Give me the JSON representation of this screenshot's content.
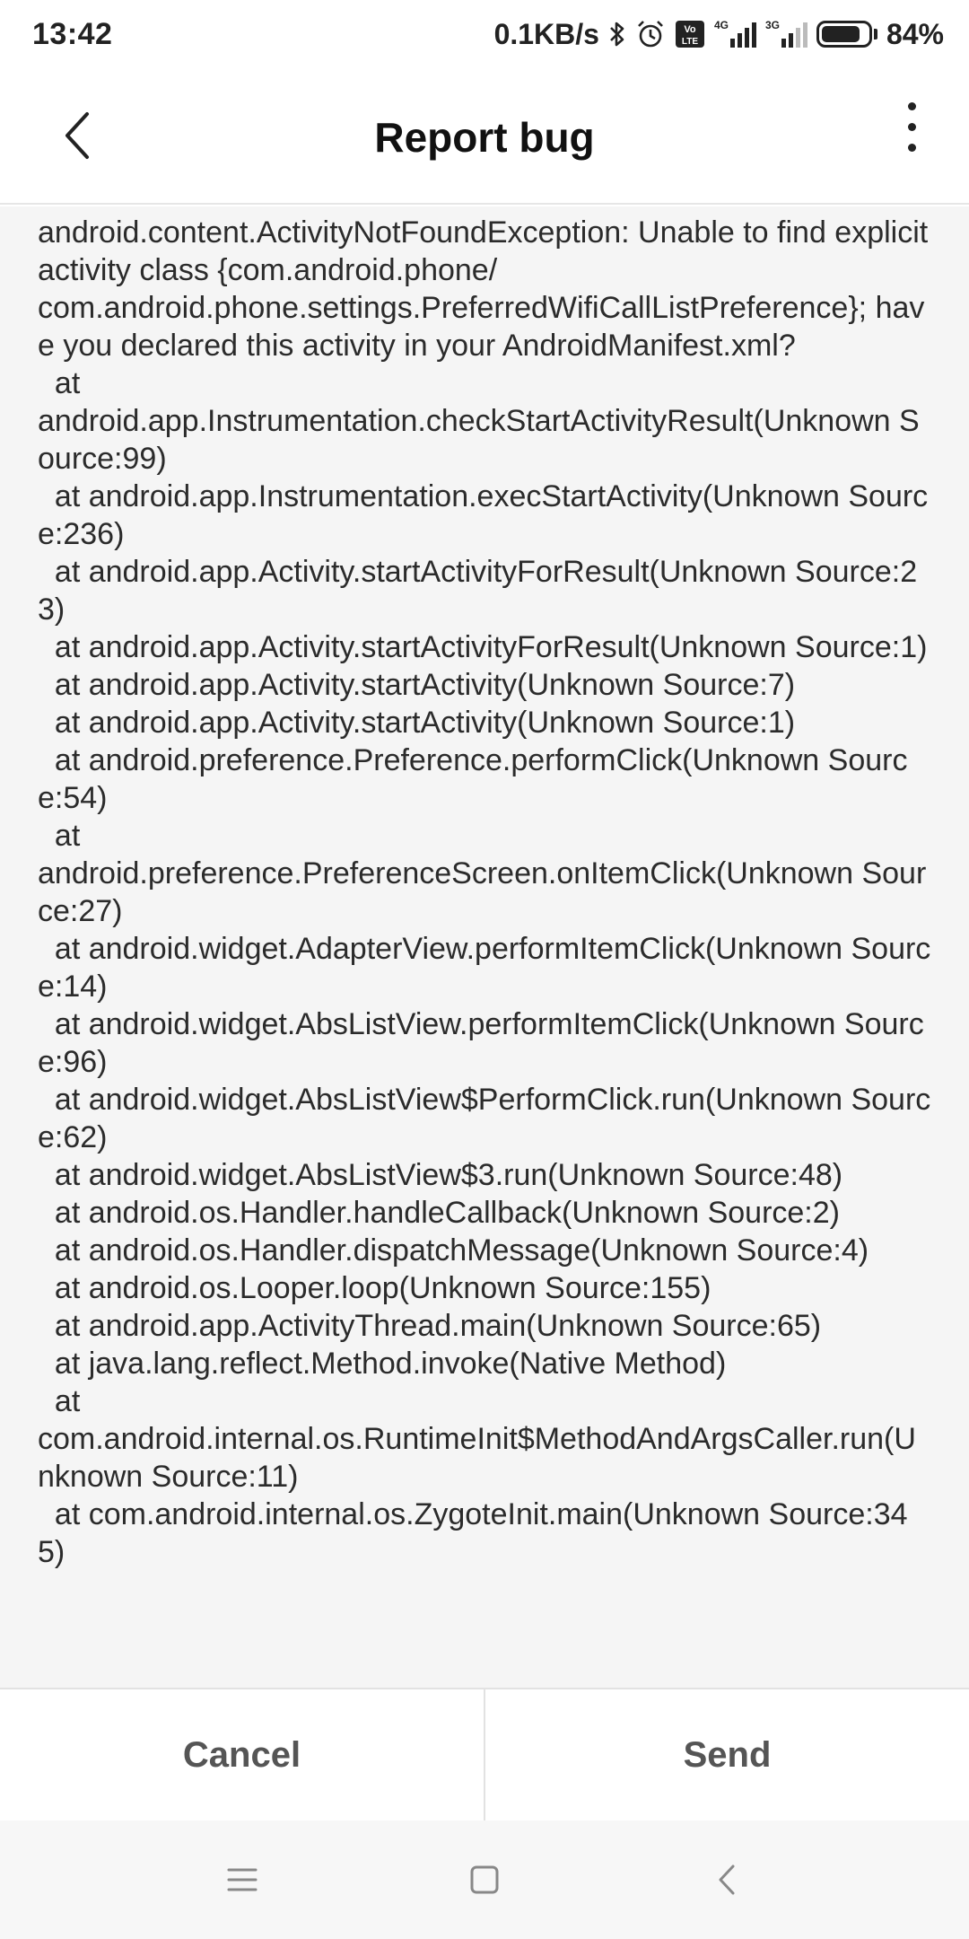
{
  "status_bar": {
    "time": "13:42",
    "net_speed": "0.1KB/s",
    "battery": "84%",
    "signal1_tag": "4G",
    "signal2_tag": "3G",
    "volte_label": "Vo LTE",
    "icons": [
      "bluetooth-icon",
      "alarm-icon",
      "volte-icon",
      "signal-4g-icon",
      "signal-3g-icon",
      "battery-icon"
    ]
  },
  "app_bar": {
    "title": "Report bug",
    "icons": [
      "back-arrow-icon",
      "more-vert-icon"
    ]
  },
  "report": {
    "text": "android.content.ActivityNotFoundException: Unable to find explicit activity class {com.android.phone/\ncom.android.phone.settings.PreferredWifiCallListPreference}; have you declared this activity in your AndroidManifest.xml?\n  at\nandroid.app.Instrumentation.checkStartActivityResult(Unknown Source:99)\n  at android.app.Instrumentation.execStartActivity(Unknown Source:236)\n  at android.app.Activity.startActivityForResult(Unknown Source:23)\n  at android.app.Activity.startActivityForResult(Unknown Source:1)\n  at android.app.Activity.startActivity(Unknown Source:7)\n  at android.app.Activity.startActivity(Unknown Source:1)\n  at android.preference.Preference.performClick(Unknown Source:54)\n  at\nandroid.preference.PreferenceScreen.onItemClick(Unknown Source:27)\n  at android.widget.AdapterView.performItemClick(Unknown Source:14)\n  at android.widget.AbsListView.performItemClick(Unknown Source:96)\n  at android.widget.AbsListView$PerformClick.run(Unknown Source:62)\n  at android.widget.AbsListView$3.run(Unknown Source:48)\n  at android.os.Handler.handleCallback(Unknown Source:2)\n  at android.os.Handler.dispatchMessage(Unknown Source:4)\n  at android.os.Looper.loop(Unknown Source:155)\n  at android.app.ActivityThread.main(Unknown Source:65)\n  at java.lang.reflect.Method.invoke(Native Method)\n  at\ncom.android.internal.os.RuntimeInit$MethodAndArgsCaller.run(Unknown Source:11)\n  at com.android.internal.os.ZygoteInit.main(Unknown Source:345)"
  },
  "actions": {
    "cancel_label": "Cancel",
    "send_label": "Send"
  },
  "nav_bar": {
    "icons": [
      "menu-icon",
      "home-icon",
      "back-icon"
    ]
  }
}
